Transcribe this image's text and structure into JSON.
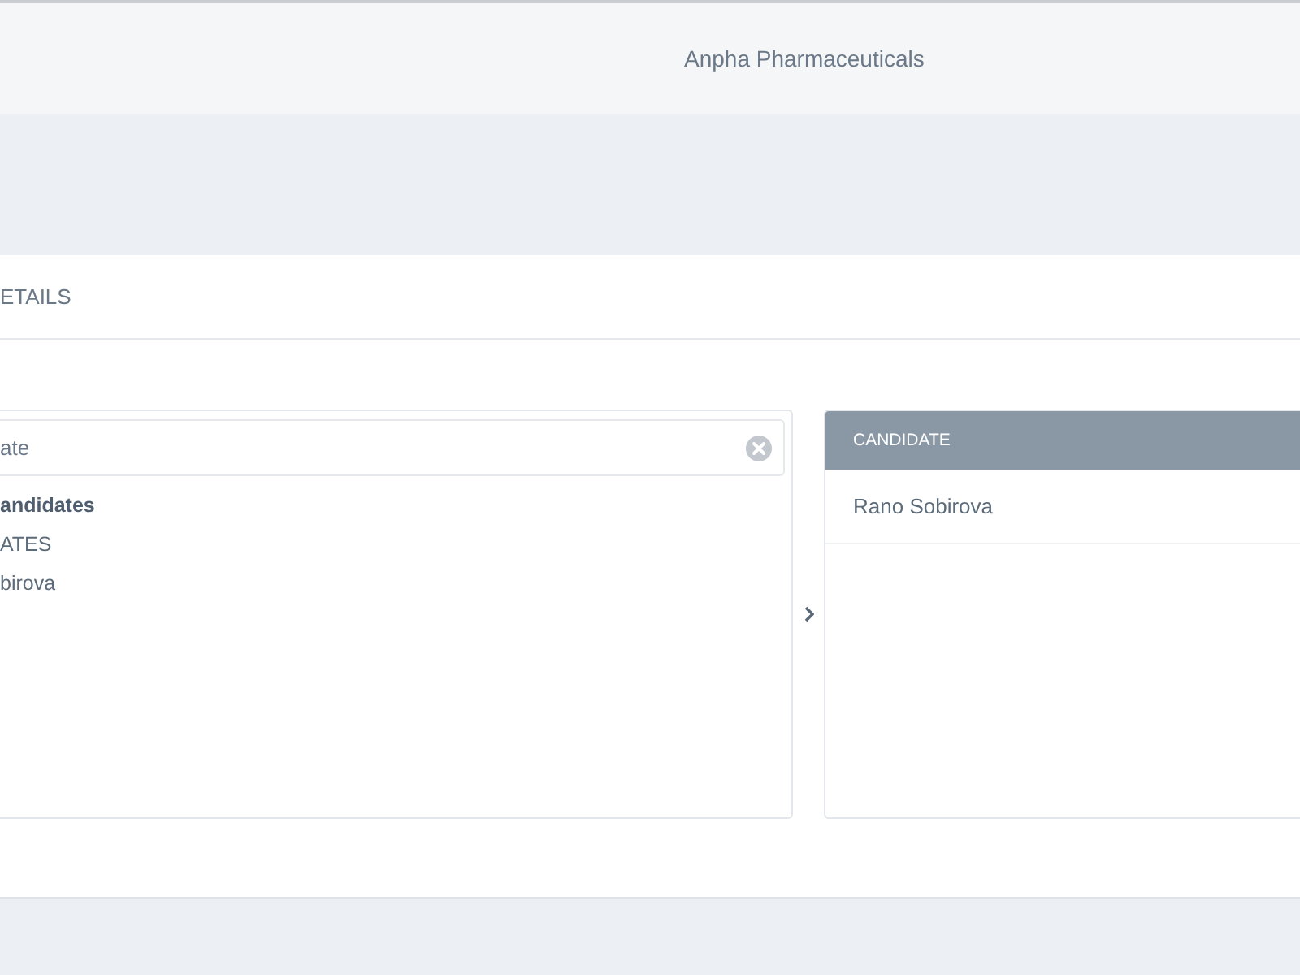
{
  "header": {
    "title": "Anpha Pharmaceuticals"
  },
  "section": {
    "title": "ETAILS"
  },
  "source_list": {
    "search": {
      "value": "ate"
    },
    "items": [
      {
        "kind": "group",
        "label": "andidates"
      },
      {
        "kind": "heading",
        "label": "ATES"
      },
      {
        "kind": "option",
        "label": "birova"
      }
    ]
  },
  "target_list": {
    "columns": [
      "CANDIDATE"
    ],
    "rows": [
      {
        "cells": [
          "Rano Sobirova"
        ]
      }
    ]
  }
}
